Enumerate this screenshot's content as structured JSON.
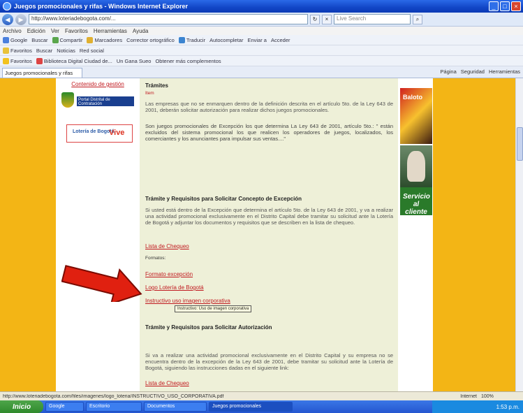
{
  "window": {
    "title": "Juegos promocionales y rifas - Windows Internet Explorer",
    "min": "_",
    "max": "□",
    "close": "×"
  },
  "address": {
    "url": "http://www.loteriadebogota.com/...",
    "search_placeholder": "Live Search"
  },
  "menu": [
    "Archivo",
    "Edición",
    "Ver",
    "Favoritos",
    "Herramientas",
    "Ayuda"
  ],
  "toolbar1": {
    "items": [
      "Google",
      "Buscar",
      "Compartir",
      "Marcadores",
      "Corrector ortográfico",
      "Traducir",
      "Autocompletar",
      "Enviar a",
      "Acceder"
    ]
  },
  "toolbar2": {
    "items": [
      "Favoritos",
      "Buscar",
      "Noticias",
      "Red social"
    ]
  },
  "toolbar3": {
    "items": [
      "Favoritos",
      "Biblioteca Digital Ciudad de...",
      "Un Gana Sueo",
      "Obtener más complementos"
    ]
  },
  "tab": {
    "label": "Juegos promocionales y rifas"
  },
  "cmdbar": [
    "Página",
    "Seguridad",
    "Herramientas"
  ],
  "left": {
    "contenido_link": "Contenido de gestión",
    "portal_badge": "Portal Distrital de Contratación",
    "logo_text": "Lotería de Bogotá",
    "logo_sub": "Vive"
  },
  "main": {
    "tramites_title": "Trámites",
    "tramites_small": "Item",
    "para1": "Las empresas que no se enmarquen dentro de la definición descrita en el artículo 5to. de la Ley 643 de 2001, deberán solicitar autorización para realizar dichos juegos promocionales.",
    "para2": "Son juegos promocionales de Excepción los que determina La Ley 643 de 2001, artículo 5to.: \" están excluidos del sistema promocional los que realicen los operadores de juegos, localizados, los comerciantes y los anunciantes para impulsar sus ventas....\"",
    "tramite_exc_title": "Trámite y Requisitos para Solicitar Concepto de Excepción",
    "para3": "Si usted está dentro de la Excepción que determina el artículo 5to. de la Ley 643 de 2001, y va a realizar una actividad promocional exclusivamente en el Distrito Capital debe tramitar su solicitud ante la Lotería de Bogotá y adjuntar los documentos y requisitos que se describen en la lista de chequeo.",
    "link_lista": "Lista de Chequeo",
    "formatos_label": "Formatos:",
    "link_formato": "Formato excepción",
    "link_logo": "Logo Lotería de Bogotá",
    "link_instructivo": "Instructivo uso imagen corporativa",
    "tooltip": "Instructivo: Uso de imagen corporativa",
    "tramite_aut_title": "Trámite y Requisitos para Solicitar Autorización",
    "para4": "Si va a realizar una actividad promocional exclusivamente en el Distrito Capital y su empresa no se encuentra dentro de la excepción de la Ley 643 de 2001, debe tramitar su solicitud ante la Lotería de Bogotá, siguiendo las instrucciones dadas en el siguiente link:",
    "link_lista2": "Lista de Chequeo"
  },
  "right": {
    "ad1": "Baloto",
    "ad3": "Servicio al cliente"
  },
  "status": {
    "url": "http://www.loteriadebogota.com/files/imagenes/logo_loteria/INSTRUCTIVO_USO_CORPORATIVA.pdf",
    "zone": "Internet",
    "zoom": "100%"
  },
  "taskbar": {
    "start": "Inicio",
    "items": [
      "Google",
      "Escritorio",
      "Documentos",
      "Juegos promocionales"
    ],
    "clock": "1:53 p.m."
  }
}
